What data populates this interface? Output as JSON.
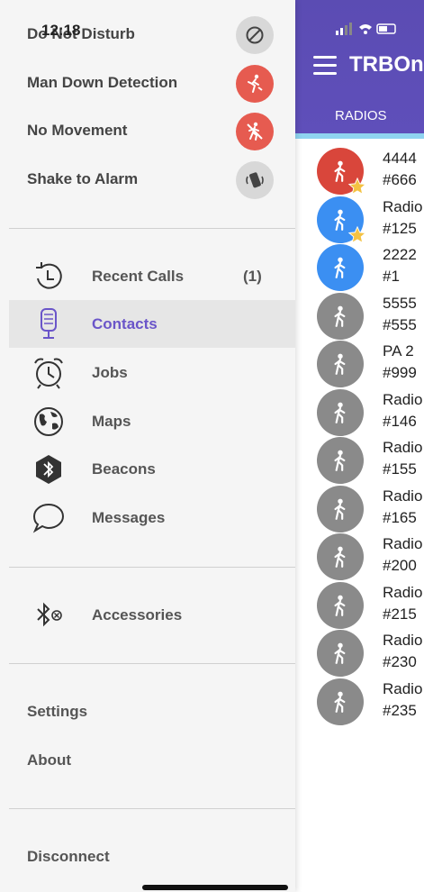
{
  "status": {
    "time": "12:18"
  },
  "app": {
    "title": "TRBOn",
    "tab": "RADIOS"
  },
  "drawer": {
    "toggles": [
      {
        "label": "Do Not Disturb",
        "icon": "do-not-disturb-icon",
        "color": "#d8d8d8"
      },
      {
        "label": "Man Down Detection",
        "icon": "man-down-icon",
        "color": "#e65b50"
      },
      {
        "label": "No Movement",
        "icon": "no-movement-icon",
        "color": "#e65b50"
      },
      {
        "label": "Shake to Alarm",
        "icon": "shake-alarm-icon",
        "color": "#d8d8d8"
      }
    ],
    "nav": [
      {
        "label": "Recent Calls",
        "count": "(1)",
        "icon": "recent-calls-icon"
      },
      {
        "label": "Contacts",
        "count": "",
        "icon": "microphone-icon",
        "active": true
      },
      {
        "label": "Jobs",
        "count": "",
        "icon": "alarm-clock-icon"
      },
      {
        "label": "Maps",
        "count": "",
        "icon": "globe-icon"
      },
      {
        "label": "Beacons",
        "count": "",
        "icon": "bluetooth-beacon-icon"
      },
      {
        "label": "Messages",
        "count": "",
        "icon": "chat-bubble-icon"
      }
    ],
    "accessories": {
      "label": "Accessories",
      "icon": "bluetooth-off-icon"
    },
    "settings": "Settings",
    "about": "About",
    "disconnect": "Disconnect"
  },
  "radios": [
    {
      "name": "4444",
      "id": "#666",
      "color": "#d9463b",
      "star": true
    },
    {
      "name": "Radio",
      "id": "#125",
      "color": "#3b8ff2",
      "star": true
    },
    {
      "name": "2222",
      "id": "#1",
      "color": "#3b8ff2",
      "star": false
    },
    {
      "name": "5555",
      "id": "#555",
      "color": "#8a8a8a",
      "star": false
    },
    {
      "name": "PA 2",
      "id": "#999",
      "color": "#8a8a8a",
      "star": false
    },
    {
      "name": "Radio",
      "id": "#146",
      "color": "#8a8a8a",
      "star": false
    },
    {
      "name": "Radio",
      "id": "#155",
      "color": "#8a8a8a",
      "star": false
    },
    {
      "name": "Radio",
      "id": "#165",
      "color": "#8a8a8a",
      "star": false
    },
    {
      "name": "Radio",
      "id": "#200",
      "color": "#8a8a8a",
      "star": false
    },
    {
      "name": "Radio",
      "id": "#215",
      "color": "#8a8a8a",
      "star": false
    },
    {
      "name": "Radio",
      "id": "#230",
      "color": "#8a8a8a",
      "star": false
    },
    {
      "name": "Radio",
      "id": "#235",
      "color": "#8a8a8a",
      "star": false
    }
  ]
}
